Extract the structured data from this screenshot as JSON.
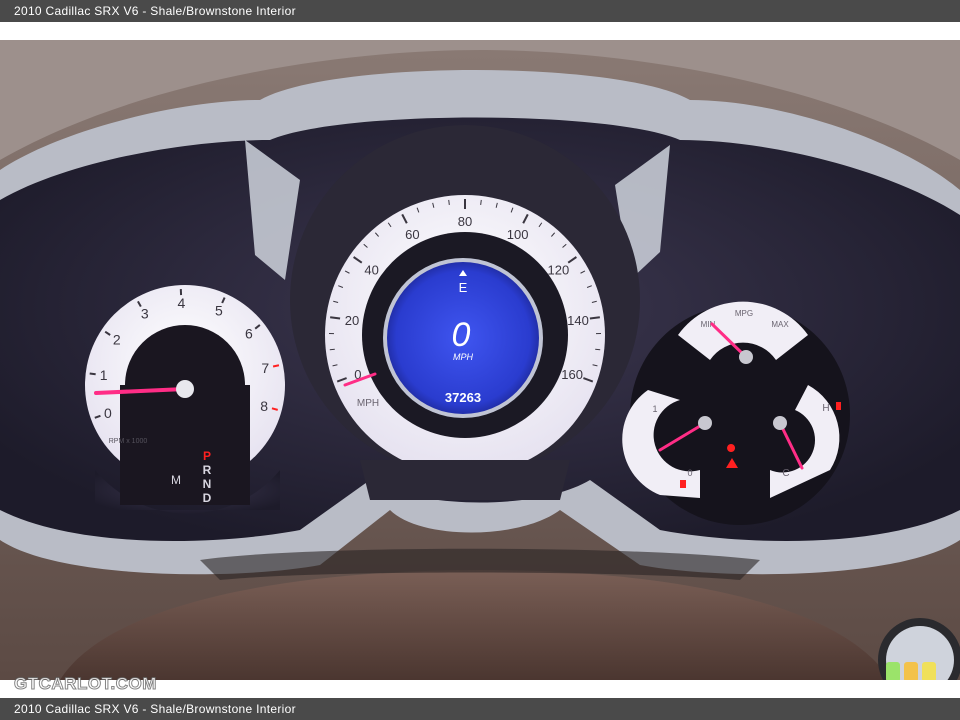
{
  "caption": {
    "top": "2010 Cadillac SRX V6 - Shale/Brownstone Interior",
    "bottom": "2010 Cadillac SRX V6 - Shale/Brownstone Interior"
  },
  "watermark": "GTCARLOT.COM",
  "tachometer": {
    "ticks": [
      "0",
      "1",
      "2",
      "3",
      "4",
      "5",
      "6",
      "7",
      "8"
    ],
    "unit_label": "RPM x 1000",
    "gear_letters": [
      "P",
      "R",
      "N",
      "D"
    ],
    "manual_letter": "M",
    "needle_value": 0.9
  },
  "speedometer": {
    "ticks": [
      "0",
      "20",
      "40",
      "60",
      "80",
      "100",
      "120",
      "140",
      "160"
    ],
    "unit_label": "MPH",
    "needle_value": 0
  },
  "info_display": {
    "compass": "E",
    "speed": "0",
    "speed_unit": "MPH",
    "odometer": "37263"
  },
  "fuel_economy_gauge": {
    "label": "MPG",
    "min_label": "MIN",
    "max_label": "MAX"
  },
  "fuel_gauge": {
    "full_label": "1",
    "empty_label": "0"
  },
  "temperature_gauge": {
    "hot_label": "H",
    "cold_label": "C"
  },
  "colors": {
    "needle": "#ff2d86",
    "display_blue": "#2a3cd8",
    "bezel_silver": "#b9bcc6",
    "dash_leather": "#6e5a52",
    "gear_highlight": "#ff2020"
  }
}
